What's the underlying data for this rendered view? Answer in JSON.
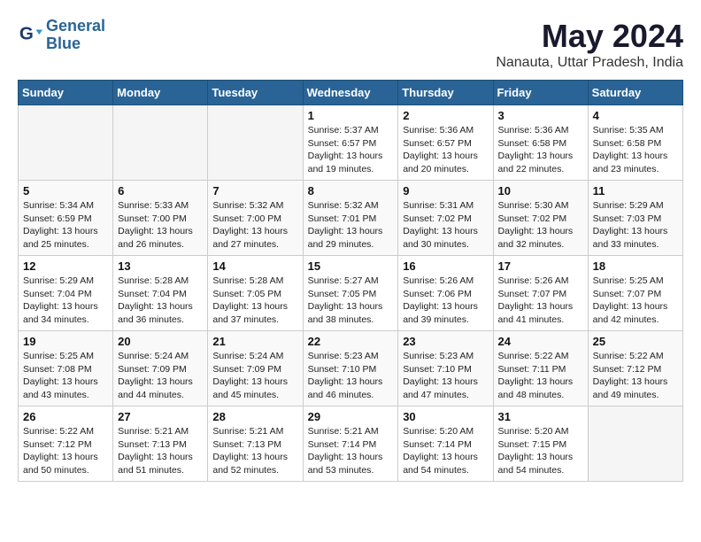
{
  "logo": {
    "text_general": "General",
    "text_blue": "Blue"
  },
  "header": {
    "month": "May 2024",
    "location": "Nanauta, Uttar Pradesh, India"
  },
  "weekdays": [
    "Sunday",
    "Monday",
    "Tuesday",
    "Wednesday",
    "Thursday",
    "Friday",
    "Saturday"
  ],
  "weeks": [
    [
      {
        "day": "",
        "info": ""
      },
      {
        "day": "",
        "info": ""
      },
      {
        "day": "",
        "info": ""
      },
      {
        "day": "1",
        "info": "Sunrise: 5:37 AM\nSunset: 6:57 PM\nDaylight: 13 hours\nand 19 minutes."
      },
      {
        "day": "2",
        "info": "Sunrise: 5:36 AM\nSunset: 6:57 PM\nDaylight: 13 hours\nand 20 minutes."
      },
      {
        "day": "3",
        "info": "Sunrise: 5:36 AM\nSunset: 6:58 PM\nDaylight: 13 hours\nand 22 minutes."
      },
      {
        "day": "4",
        "info": "Sunrise: 5:35 AM\nSunset: 6:58 PM\nDaylight: 13 hours\nand 23 minutes."
      }
    ],
    [
      {
        "day": "5",
        "info": "Sunrise: 5:34 AM\nSunset: 6:59 PM\nDaylight: 13 hours\nand 25 minutes."
      },
      {
        "day": "6",
        "info": "Sunrise: 5:33 AM\nSunset: 7:00 PM\nDaylight: 13 hours\nand 26 minutes."
      },
      {
        "day": "7",
        "info": "Sunrise: 5:32 AM\nSunset: 7:00 PM\nDaylight: 13 hours\nand 27 minutes."
      },
      {
        "day": "8",
        "info": "Sunrise: 5:32 AM\nSunset: 7:01 PM\nDaylight: 13 hours\nand 29 minutes."
      },
      {
        "day": "9",
        "info": "Sunrise: 5:31 AM\nSunset: 7:02 PM\nDaylight: 13 hours\nand 30 minutes."
      },
      {
        "day": "10",
        "info": "Sunrise: 5:30 AM\nSunset: 7:02 PM\nDaylight: 13 hours\nand 32 minutes."
      },
      {
        "day": "11",
        "info": "Sunrise: 5:29 AM\nSunset: 7:03 PM\nDaylight: 13 hours\nand 33 minutes."
      }
    ],
    [
      {
        "day": "12",
        "info": "Sunrise: 5:29 AM\nSunset: 7:04 PM\nDaylight: 13 hours\nand 34 minutes."
      },
      {
        "day": "13",
        "info": "Sunrise: 5:28 AM\nSunset: 7:04 PM\nDaylight: 13 hours\nand 36 minutes."
      },
      {
        "day": "14",
        "info": "Sunrise: 5:28 AM\nSunset: 7:05 PM\nDaylight: 13 hours\nand 37 minutes."
      },
      {
        "day": "15",
        "info": "Sunrise: 5:27 AM\nSunset: 7:05 PM\nDaylight: 13 hours\nand 38 minutes."
      },
      {
        "day": "16",
        "info": "Sunrise: 5:26 AM\nSunset: 7:06 PM\nDaylight: 13 hours\nand 39 minutes."
      },
      {
        "day": "17",
        "info": "Sunrise: 5:26 AM\nSunset: 7:07 PM\nDaylight: 13 hours\nand 41 minutes."
      },
      {
        "day": "18",
        "info": "Sunrise: 5:25 AM\nSunset: 7:07 PM\nDaylight: 13 hours\nand 42 minutes."
      }
    ],
    [
      {
        "day": "19",
        "info": "Sunrise: 5:25 AM\nSunset: 7:08 PM\nDaylight: 13 hours\nand 43 minutes."
      },
      {
        "day": "20",
        "info": "Sunrise: 5:24 AM\nSunset: 7:09 PM\nDaylight: 13 hours\nand 44 minutes."
      },
      {
        "day": "21",
        "info": "Sunrise: 5:24 AM\nSunset: 7:09 PM\nDaylight: 13 hours\nand 45 minutes."
      },
      {
        "day": "22",
        "info": "Sunrise: 5:23 AM\nSunset: 7:10 PM\nDaylight: 13 hours\nand 46 minutes."
      },
      {
        "day": "23",
        "info": "Sunrise: 5:23 AM\nSunset: 7:10 PM\nDaylight: 13 hours\nand 47 minutes."
      },
      {
        "day": "24",
        "info": "Sunrise: 5:22 AM\nSunset: 7:11 PM\nDaylight: 13 hours\nand 48 minutes."
      },
      {
        "day": "25",
        "info": "Sunrise: 5:22 AM\nSunset: 7:12 PM\nDaylight: 13 hours\nand 49 minutes."
      }
    ],
    [
      {
        "day": "26",
        "info": "Sunrise: 5:22 AM\nSunset: 7:12 PM\nDaylight: 13 hours\nand 50 minutes."
      },
      {
        "day": "27",
        "info": "Sunrise: 5:21 AM\nSunset: 7:13 PM\nDaylight: 13 hours\nand 51 minutes."
      },
      {
        "day": "28",
        "info": "Sunrise: 5:21 AM\nSunset: 7:13 PM\nDaylight: 13 hours\nand 52 minutes."
      },
      {
        "day": "29",
        "info": "Sunrise: 5:21 AM\nSunset: 7:14 PM\nDaylight: 13 hours\nand 53 minutes."
      },
      {
        "day": "30",
        "info": "Sunrise: 5:20 AM\nSunset: 7:14 PM\nDaylight: 13 hours\nand 54 minutes."
      },
      {
        "day": "31",
        "info": "Sunrise: 5:20 AM\nSunset: 7:15 PM\nDaylight: 13 hours\nand 54 minutes."
      },
      {
        "day": "",
        "info": ""
      }
    ]
  ]
}
